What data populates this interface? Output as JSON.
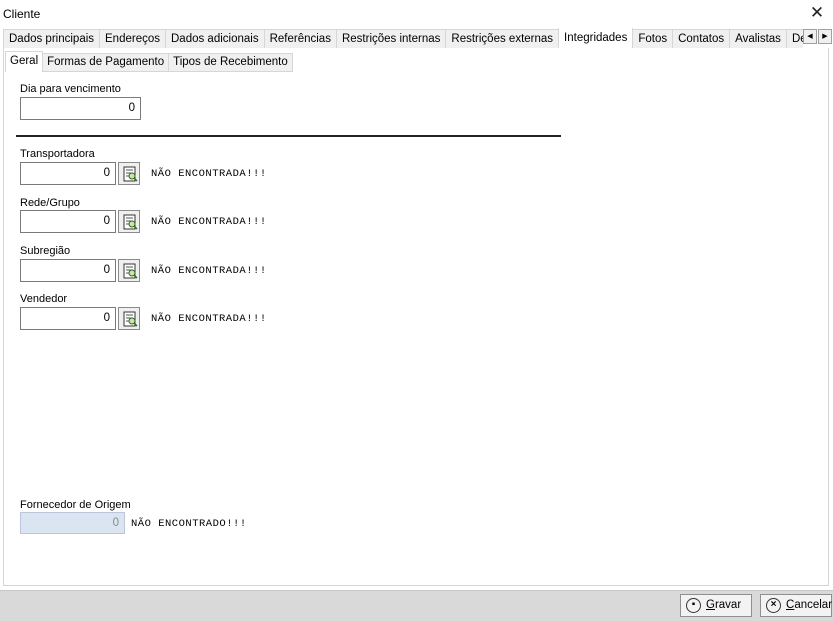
{
  "window": {
    "title": "Cliente",
    "close_glyph": "✕"
  },
  "tabs": [
    {
      "label": "Dados principais",
      "active": false
    },
    {
      "label": "Endereços",
      "active": false
    },
    {
      "label": "Dados adicionais",
      "active": false
    },
    {
      "label": "Referências",
      "active": false
    },
    {
      "label": "Restrições internas",
      "active": false
    },
    {
      "label": "Restrições externas",
      "active": false
    },
    {
      "label": "Integridades",
      "active": true
    },
    {
      "label": "Fotos",
      "active": false
    },
    {
      "label": "Contatos",
      "active": false
    },
    {
      "label": "Avalistas",
      "active": false
    },
    {
      "label": "Descontos",
      "active": false
    }
  ],
  "tab_scroll": {
    "left": "◀",
    "right": "▶"
  },
  "subtabs": [
    {
      "label": "Geral",
      "active": true
    },
    {
      "label": "Formas de Pagamento",
      "active": false
    },
    {
      "label": "Tipos de Recebimento",
      "active": false
    }
  ],
  "geral": {
    "dia_vencimento": {
      "label": "Dia para vencimento",
      "value": "0"
    },
    "transportadora": {
      "label": "Transportadora",
      "value": "0",
      "status": "NÃO ENCONTRADA!!!"
    },
    "rede_grupo": {
      "label": "Rede/Grupo",
      "value": "0",
      "status": "NÃO ENCONTRADA!!!"
    },
    "subregiao": {
      "label": "Subregião",
      "value": "0",
      "status": "NÃO ENCONTRADA!!!"
    },
    "vendedor": {
      "label": "Vendedor",
      "value": "0",
      "status": "NÃO ENCONTRADA!!!"
    },
    "fornecedor_origem": {
      "label": "Fornecedor de Origem",
      "value": "0",
      "status": "NÃO ENCONTRADO!!!"
    }
  },
  "icons": {
    "lookup": "search-list-icon",
    "gravar": "save-icon",
    "cancelar": "cancel-icon"
  },
  "buttons": {
    "gravar": {
      "accel": "G",
      "rest": "ravar"
    },
    "cancelar": {
      "accel": "C",
      "rest": "ancelar"
    }
  }
}
